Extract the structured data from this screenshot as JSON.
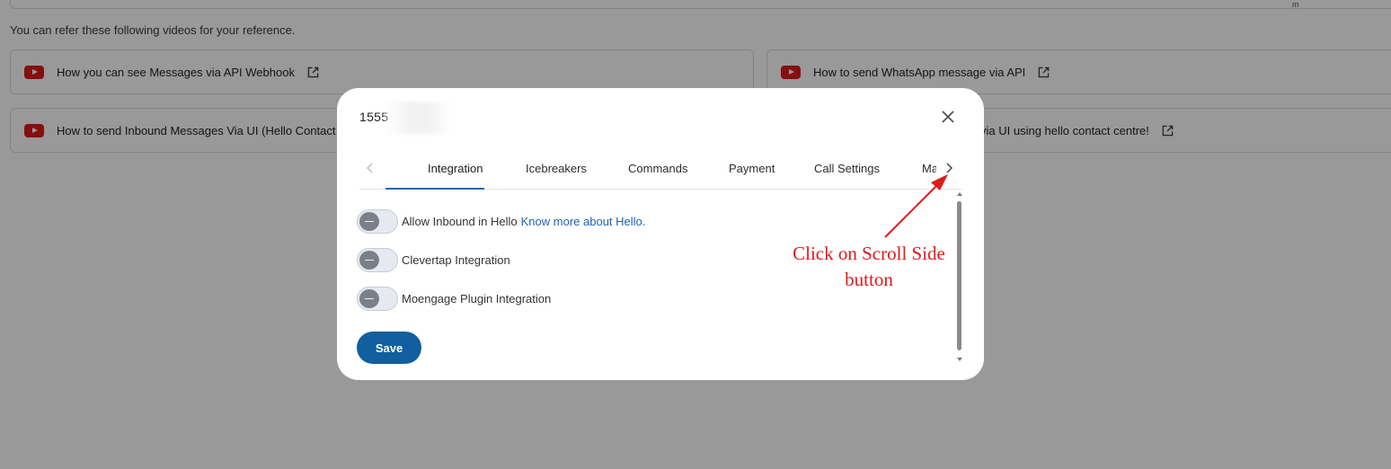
{
  "background": {
    "top_glyph": "m",
    "intro_text": "You can refer these following videos for your reference.",
    "videos": [
      {
        "title": "How you can see Messages via API Webhook"
      },
      {
        "title": "How to send WhatsApp message via API"
      },
      {
        "title": "How to send Inbound Messages Via UI (Hello Contact"
      },
      {
        "title": "via UI using hello contact centre!"
      }
    ],
    "icon_names": [
      "youtube-icon",
      "external-link-icon"
    ]
  },
  "modal": {
    "title": "1555",
    "close_icon": "close-icon",
    "tabs": [
      {
        "label": "Integration",
        "active": true
      },
      {
        "label": "Icebreakers"
      },
      {
        "label": "Commands"
      },
      {
        "label": "Payment"
      },
      {
        "label": "Call Settings"
      },
      {
        "label": "Market"
      }
    ],
    "settings": [
      {
        "label": "Allow Inbound in Hello",
        "link": "Know more about Hello.",
        "enabled": false
      },
      {
        "label": "Clevertap Integration",
        "enabled": false
      },
      {
        "label": "Moengage Plugin Integration",
        "enabled": false
      }
    ],
    "save_label": "Save"
  },
  "annotation": {
    "line1": "Click on Scroll Side",
    "line2": "button",
    "color": "#e01a1a"
  },
  "colors": {
    "accent": "#1a66b3",
    "save_button": "#115f9e",
    "youtube_red": "#e01a1a"
  }
}
